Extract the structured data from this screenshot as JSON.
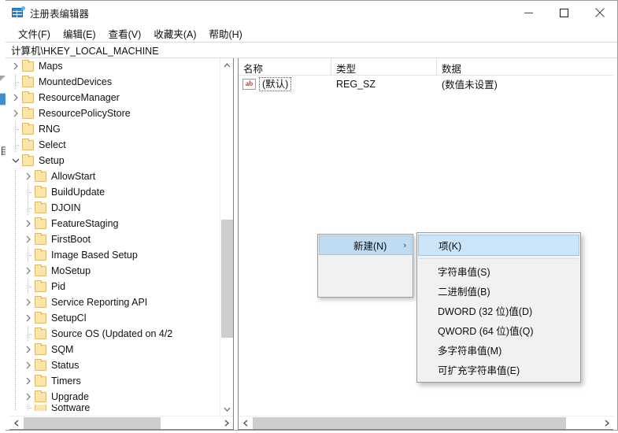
{
  "window": {
    "title": "注册表编辑器",
    "app_icon": "registry-editor-icon",
    "controls": {
      "minimize": "minimize-icon",
      "maximize": "maximize-icon",
      "close": "close-icon"
    }
  },
  "menu_bar": {
    "items": [
      {
        "label": "文件(F)"
      },
      {
        "label": "编辑(E)"
      },
      {
        "label": "查看(V)"
      },
      {
        "label": "收藏夹(A)"
      },
      {
        "label": "帮助(H)"
      }
    ]
  },
  "address_bar": {
    "path": "计算机\\HKEY_LOCAL_MACHINE"
  },
  "tree": {
    "items": [
      {
        "label": "Maps",
        "indent": 0,
        "expander": "collapsed"
      },
      {
        "label": "MountedDevices",
        "indent": 0,
        "expander": "none"
      },
      {
        "label": "ResourceManager",
        "indent": 0,
        "expander": "collapsed"
      },
      {
        "label": "ResourcePolicyStore",
        "indent": 0,
        "expander": "collapsed"
      },
      {
        "label": "RNG",
        "indent": 0,
        "expander": "none"
      },
      {
        "label": "Select",
        "indent": 0,
        "expander": "none"
      },
      {
        "label": "Setup",
        "indent": 0,
        "expander": "expanded"
      },
      {
        "label": "AllowStart",
        "indent": 1,
        "expander": "collapsed"
      },
      {
        "label": "BuildUpdate",
        "indent": 1,
        "expander": "none"
      },
      {
        "label": "DJOIN",
        "indent": 1,
        "expander": "none"
      },
      {
        "label": "FeatureStaging",
        "indent": 1,
        "expander": "collapsed"
      },
      {
        "label": "FirstBoot",
        "indent": 1,
        "expander": "collapsed"
      },
      {
        "label": "Image Based Setup",
        "indent": 1,
        "expander": "none"
      },
      {
        "label": "MoSetup",
        "indent": 1,
        "expander": "collapsed"
      },
      {
        "label": "Pid",
        "indent": 1,
        "expander": "none"
      },
      {
        "label": "Service Reporting API",
        "indent": 1,
        "expander": "collapsed"
      },
      {
        "label": "SetupCl",
        "indent": 1,
        "expander": "collapsed"
      },
      {
        "label": "Source OS (Updated on 4/2",
        "indent": 1,
        "expander": "none"
      },
      {
        "label": "SQM",
        "indent": 1,
        "expander": "collapsed"
      },
      {
        "label": "Status",
        "indent": 1,
        "expander": "collapsed"
      },
      {
        "label": "Timers",
        "indent": 1,
        "expander": "collapsed"
      },
      {
        "label": "Upgrade",
        "indent": 1,
        "expander": "collapsed"
      }
    ]
  },
  "list": {
    "columns": [
      {
        "label": "名称"
      },
      {
        "label": "类型"
      },
      {
        "label": "数据"
      }
    ],
    "rows": [
      {
        "name": "(默认)",
        "type": "REG_SZ",
        "data": "(数值未设置)",
        "icon": "string-value-icon"
      }
    ]
  },
  "context_menu": {
    "parent_item": {
      "label": "新建(N)",
      "submenu_arrow": "chevron-right-icon"
    },
    "submenu": {
      "items": [
        {
          "label": "项(K)",
          "selected": true,
          "separator_after": true
        },
        {
          "label": "字符串值(S)",
          "selected": false
        },
        {
          "label": "二进制值(B)",
          "selected": false
        },
        {
          "label": "DWORD (32 位)值(D)",
          "selected": false
        },
        {
          "label": "QWORD (64 位)值(Q)",
          "selected": false
        },
        {
          "label": "多字符串值(M)",
          "selected": false
        },
        {
          "label": "可扩充字符串值(E)",
          "selected": false
        }
      ]
    }
  },
  "colors": {
    "selection_blue": "#cce4f7",
    "parent_highlight": "#bfdcf2",
    "folder_fill": "#fbe5a8",
    "menu_bg": "#f1f1f1"
  }
}
